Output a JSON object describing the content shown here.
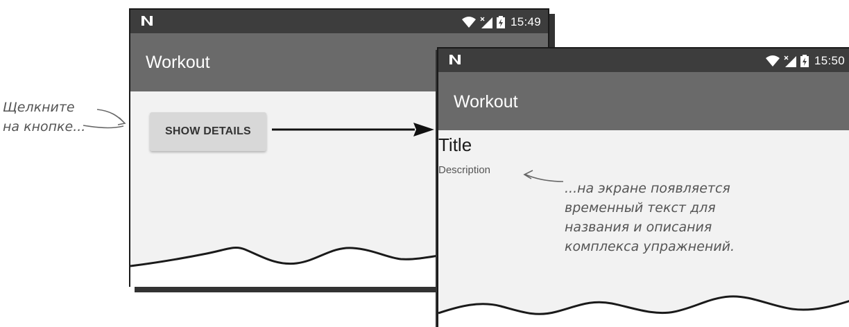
{
  "phone1": {
    "status_time": "15:49",
    "app_title": "Workout",
    "button_label": "SHOW DETAILS"
  },
  "phone2": {
    "status_time": "15:50",
    "app_title": "Workout",
    "fragment_title": "Title",
    "fragment_description": "Description"
  },
  "annotations": {
    "click_note": "Щелкните\nна кнопке...",
    "result_note": "...на экране появляется\nвременный текст для\nназвания и описания\nкомплекса упражнений."
  },
  "icons": [
    "n-logo-icon",
    "wifi-icon",
    "signal-icon",
    "battery-icon",
    "arrow-icon"
  ],
  "colors": {
    "statusbar": "#3d3d3d",
    "appbar": "#6a6a6a",
    "screen_bg": "#f2f2f2",
    "button_bg": "#d8d8d8"
  }
}
